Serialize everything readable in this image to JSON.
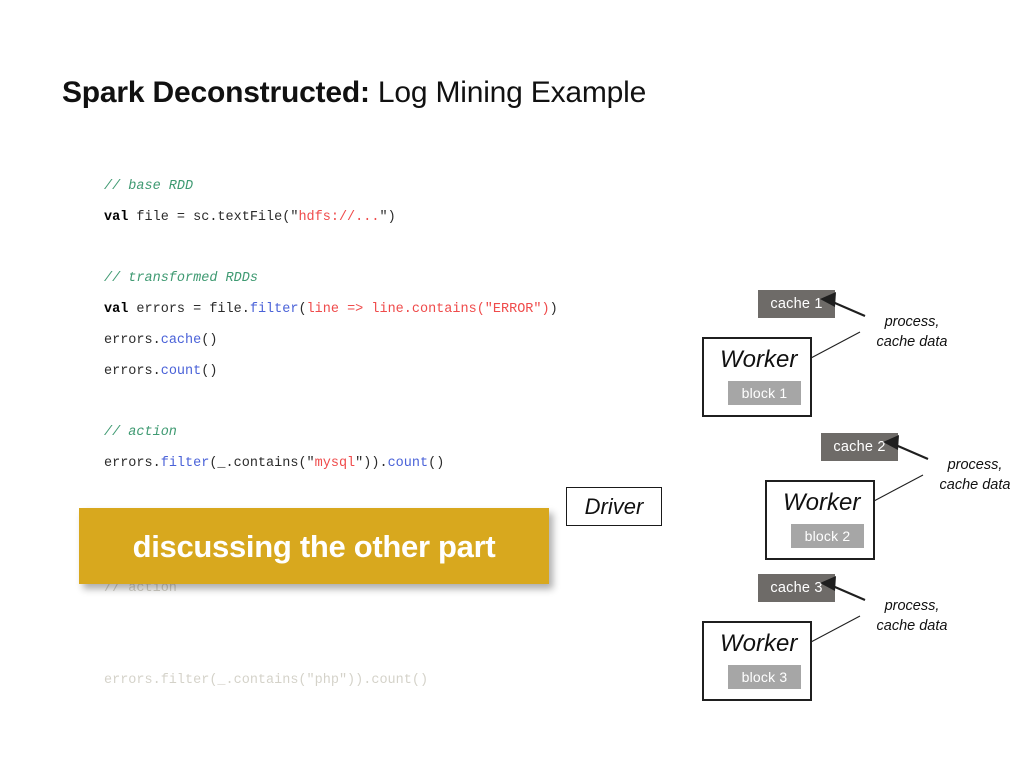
{
  "slide": {
    "title_bold": "Spark Deconstructed:",
    "title_light": " Log Mining Example",
    "background": "#ffffff"
  },
  "colors": {
    "comment": "#3f9a72",
    "keyword": "#000000",
    "method": "#4a62d8",
    "string": "#ef4b4b",
    "plain": "#2b2b2b",
    "overlay_gold": "#d8a81e",
    "cache_gray": "#6e6b68",
    "block_gray": "#a6a6a6",
    "box_border": "#1f1f1f"
  },
  "code": {
    "lines": [
      {
        "id": "comment-base-rdd",
        "tokens": [
          {
            "t": "// base RDD",
            "c": "cm"
          }
        ]
      },
      {
        "id": "val-file",
        "tokens": [
          {
            "t": "val",
            "c": "kw"
          },
          {
            "t": " file = sc.textFile(\"",
            "c": "pl"
          },
          {
            "t": "hdfs://...",
            "c": "str"
          },
          {
            "t": "\")",
            "c": "pl"
          }
        ]
      },
      {
        "id": "blank-1",
        "tokens": [
          {
            "t": " ",
            "c": "pl"
          }
        ]
      },
      {
        "id": "comment-transformed",
        "tokens": [
          {
            "t": "// transformed RDDs",
            "c": "cm"
          }
        ]
      },
      {
        "id": "val-errors",
        "tokens": [
          {
            "t": "val",
            "c": "kw"
          },
          {
            "t": " errors = file.",
            "c": "pl"
          },
          {
            "t": "filter",
            "c": "mth"
          },
          {
            "t": "(",
            "c": "pl"
          },
          {
            "t": "line => line.contains(\"ERROR\")",
            "c": "str"
          },
          {
            "t": ")",
            "c": "pl"
          }
        ]
      },
      {
        "id": "errors-cache",
        "tokens": [
          {
            "t": "errors.",
            "c": "pl"
          },
          {
            "t": "cache",
            "c": "mth"
          },
          {
            "t": "()",
            "c": "pl"
          }
        ]
      },
      {
        "id": "errors-count",
        "tokens": [
          {
            "t": "errors.",
            "c": "pl"
          },
          {
            "t": "count",
            "c": "mth"
          },
          {
            "t": "()",
            "c": "pl"
          }
        ]
      },
      {
        "id": "blank-2",
        "tokens": [
          {
            "t": " ",
            "c": "pl"
          }
        ]
      },
      {
        "id": "comment-action",
        "tokens": [
          {
            "t": "// action",
            "c": "cm"
          }
        ]
      },
      {
        "id": "errors-filter-mysql",
        "tokens": [
          {
            "t": "errors.",
            "c": "pl"
          },
          {
            "t": "filter",
            "c": "mth"
          },
          {
            "t": "(_.contains(\"",
            "c": "pl"
          },
          {
            "t": "mysql",
            "c": "str"
          },
          {
            "t": "\")).",
            "c": "pl"
          },
          {
            "t": "count",
            "c": "mth"
          },
          {
            "t": "()",
            "c": "pl"
          }
        ]
      }
    ]
  },
  "obscured_code": {
    "line_1": "// action",
    "line_2": "errors.filter(_.contains(\"php\")).count()"
  },
  "overlay": {
    "text": "discussing the other part"
  },
  "diagram": {
    "driver": {
      "label": "Driver"
    },
    "workers": [
      {
        "cache_label": "cache 1",
        "worker_label": "Worker",
        "block_label": "block 1",
        "process_line_1": "process,",
        "process_line_2": "cache data"
      },
      {
        "cache_label": "cache 2",
        "worker_label": "Worker",
        "block_label": "block 2",
        "process_line_1": "process,",
        "process_line_2": "cache data"
      },
      {
        "cache_label": "cache 3",
        "worker_label": "Worker",
        "block_label": "block 3",
        "process_line_1": "process,",
        "process_line_2": "cache data"
      }
    ]
  }
}
